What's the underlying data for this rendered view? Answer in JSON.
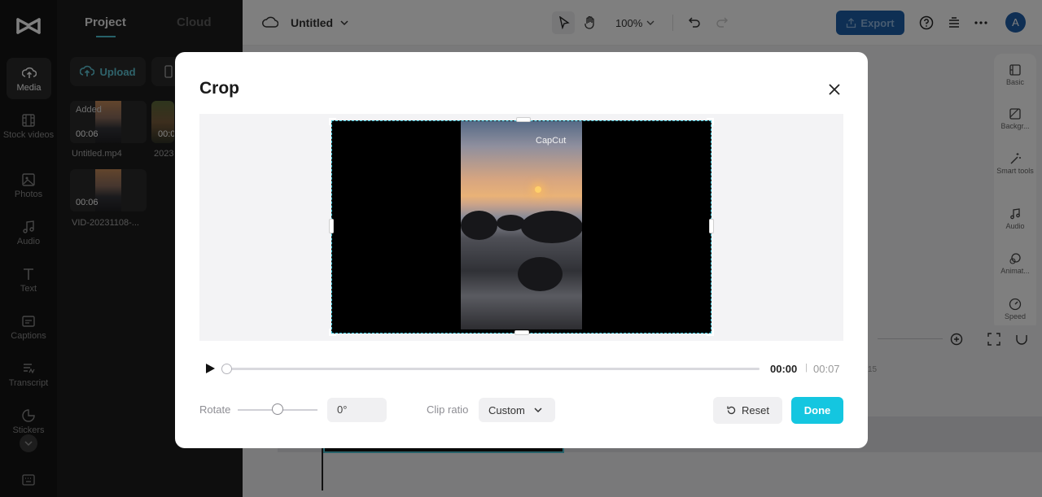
{
  "sidebar": {
    "items": [
      {
        "label": "Media",
        "icon": "cloud-upload-icon"
      },
      {
        "label": "Stock videos",
        "icon": "film-icon"
      },
      {
        "label": "Photos",
        "icon": "image-icon"
      },
      {
        "label": "Audio",
        "icon": "music-note-icon"
      },
      {
        "label": "Text",
        "icon": "text-icon"
      },
      {
        "label": "Captions",
        "icon": "captions-icon"
      },
      {
        "label": "Transcript",
        "icon": "transcript-icon"
      },
      {
        "label": "Stickers",
        "icon": "sticker-icon"
      }
    ]
  },
  "media_panel": {
    "tabs": [
      "Project",
      "Cloud"
    ],
    "upload_label": "Upload",
    "items": [
      {
        "badge": "Added",
        "duration": "00:06",
        "name": "Untitled.mp4"
      },
      {
        "badge": "",
        "duration": "00:0",
        "name": "2023"
      },
      {
        "badge": "",
        "duration": "00:06",
        "name": "VID-20231108-..."
      }
    ]
  },
  "topbar": {
    "project_title": "Untitled",
    "zoom": "100%",
    "export_label": "Export",
    "avatar_initial": "A",
    "accent_color": "#1d5fa8"
  },
  "right_panel": {
    "items": [
      {
        "label": "Basic",
        "icon": "basic-icon"
      },
      {
        "label": "Backgr...",
        "icon": "background-icon"
      },
      {
        "label": "Smart tools",
        "icon": "magic-wand-icon"
      },
      {
        "label": "Audio",
        "icon": "music-note-icon"
      },
      {
        "label": "Animat...",
        "icon": "animation-icon"
      },
      {
        "label": "Speed",
        "icon": "speed-icon"
      }
    ]
  },
  "timeline": {
    "tick_label": "15"
  },
  "crop_dialog": {
    "title": "Crop",
    "watermark": "CapCut",
    "current_time": "00:00",
    "separator": "|",
    "total_time": "00:07",
    "rotate_label": "Rotate",
    "rotate_value": "0°",
    "clip_ratio_label": "Clip ratio",
    "clip_ratio_value": "Custom",
    "reset_label": "Reset",
    "done_label": "Done",
    "done_color": "#14c6e0",
    "crop_border_color": "#39c3d7"
  }
}
